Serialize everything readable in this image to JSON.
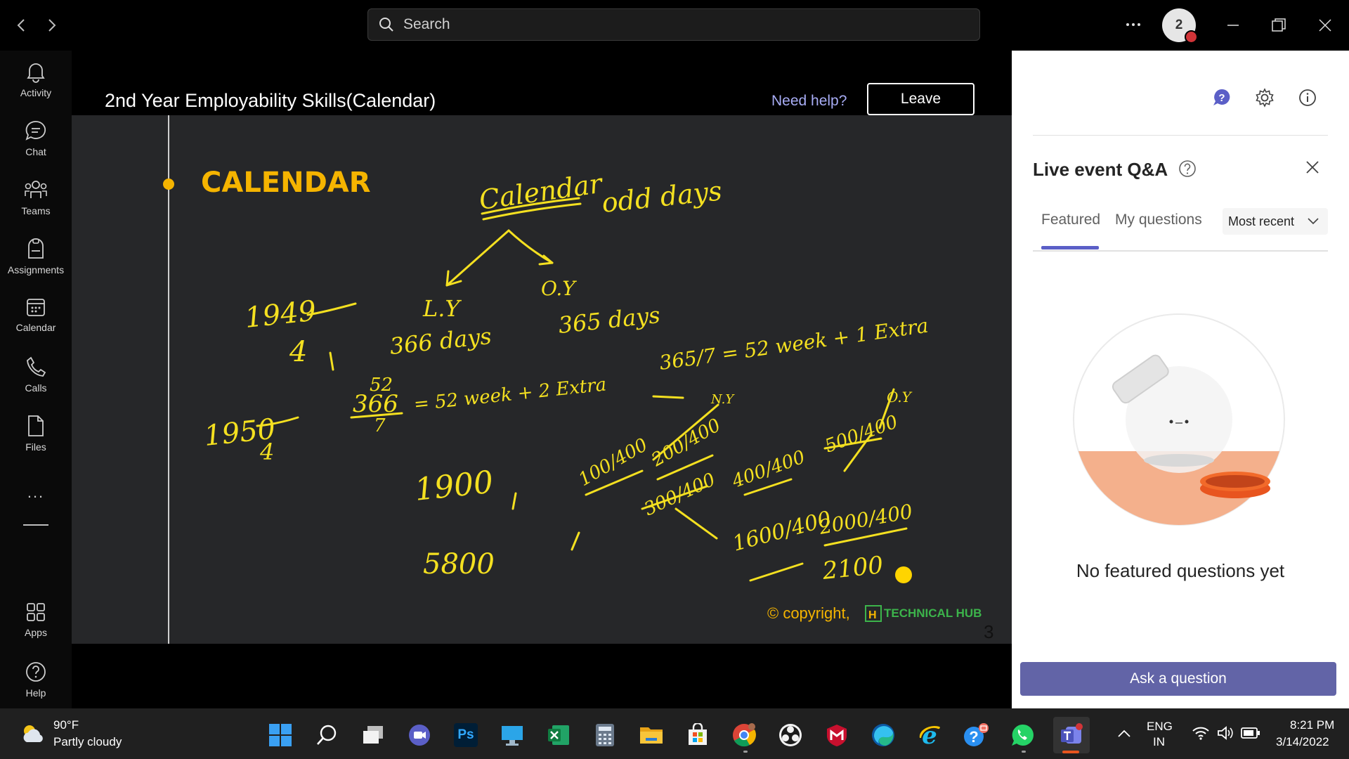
{
  "search": {
    "placeholder": "Search"
  },
  "header": {
    "avatar_text": "2"
  },
  "rail": {
    "items": [
      {
        "label": "Activity",
        "icon": "bell-icon"
      },
      {
        "label": "Chat",
        "icon": "chat-icon"
      },
      {
        "label": "Teams",
        "icon": "teams-icon"
      },
      {
        "label": "Assignments",
        "icon": "assignments-icon"
      },
      {
        "label": "Calendar",
        "icon": "calendar-icon"
      },
      {
        "label": "Calls",
        "icon": "phone-icon"
      },
      {
        "label": "Files",
        "icon": "file-icon"
      }
    ],
    "more": "...",
    "apps": "Apps",
    "help": "Help"
  },
  "stage": {
    "title": "2nd Year Employability Skills(Calendar)",
    "need_help": "Need help?",
    "leave": "Leave"
  },
  "slide": {
    "heading": "CALENDAR",
    "copyright": "© copyright,",
    "brand": "TECHNICAL HUB",
    "page_number": "3",
    "handwriting": {
      "title": "Calendar",
      "odd_days": "odd days",
      "ly": "L.Y",
      "oy": "O.Y",
      "ly_days": "366 days",
      "oy_days": "365 days",
      "y1949": "1949",
      "y1950": "1950",
      "div4": "4",
      "eq1_num": "366",
      "eq1_top": "52",
      "eq1_den": "7",
      "eq1_rhs": "= 52 week + 2 Extra",
      "eq2": "365/7 = 52 week + 1 Extra",
      "n1900": "1900",
      "n5800": "5800",
      "n100": "100/400",
      "n200": "200/400",
      "n300": "300/400",
      "n400": "400/400",
      "n500": "500/400",
      "n1600": "1600/400",
      "n2000": "2000/400",
      "n2100": "2100",
      "ny": "N.Y",
      "oy2": "O.Y"
    },
    "pointer_color": "#ffd400",
    "ink_color": "#f4e020",
    "heading_color": "#f5b400"
  },
  "qa": {
    "title": "Live event Q&A",
    "tabs": [
      "Featured",
      "My questions"
    ],
    "sort": "Most recent",
    "empty_message": "No featured questions yet",
    "ask_button": "Ask a question",
    "accent": "#6264a7"
  },
  "taskbar": {
    "weather_temp": "90°F",
    "weather_desc": "Partly cloudy",
    "lang_line1": "ENG",
    "lang_line2": "IN",
    "time": "8:21 PM",
    "date": "3/14/2022",
    "apps": [
      "start-icon",
      "search-icon",
      "task-view-icon",
      "meet-icon",
      "photoshop-icon",
      "remote-desktop-icon",
      "excel-icon",
      "calculator-icon",
      "file-explorer-icon",
      "store-icon",
      "chrome-icon",
      "obs-icon",
      "mcafee-icon",
      "edge-icon",
      "internet-explorer-icon",
      "help-icon",
      "whatsapp-icon",
      "teams-icon"
    ],
    "ps_label": "Ps"
  }
}
